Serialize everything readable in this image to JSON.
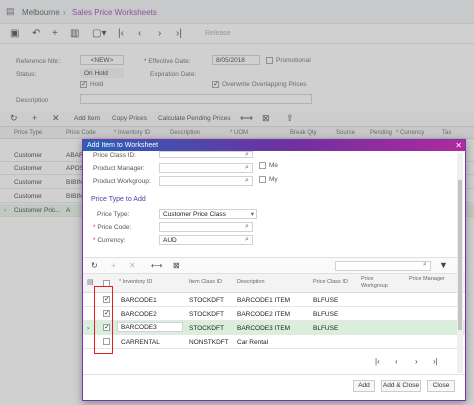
{
  "breadcrumb": {
    "site": "Melbourne",
    "separator": "›",
    "screen": "Sales Price Worksheets"
  },
  "toolbar": {
    "release_label": "Release"
  },
  "form": {
    "reference_label": "Reference Nbr.:",
    "reference_value": "<NEW>",
    "status_label": "Status:",
    "status_value": "On Hold",
    "hold_label": "Hold",
    "effective_label": "Effective Date:",
    "effective_value": "8/05/2018",
    "promotional_label": "Promotional",
    "expiration_label": "Expiration Date:",
    "overwrite_label": "Overwrite Overlapping Prices",
    "description_label": "Description"
  },
  "grid_toolbar": {
    "add_item": "Add Item",
    "copy_prices": "Copy Prices",
    "calc_pending": "Calculate Pending Prices"
  },
  "grid_headers": [
    "Price Type",
    "Price Code",
    "* Inventory ID",
    "Description",
    "* UOM",
    "Break Qty",
    "Source",
    "Pending",
    "* Currency",
    "Tax"
  ],
  "bg_rows": [
    {
      "price_type": "Customer",
      "price_code": "ABAR"
    },
    {
      "price_type": "Customer",
      "price_code": "APOS"
    },
    {
      "price_type": "Customer",
      "price_code": "BIBIN"
    },
    {
      "price_type": "Customer",
      "price_code": "BIBIN"
    },
    {
      "price_type": "Customer Pric...",
      "price_code": "A"
    }
  ],
  "dialog": {
    "title": "Add Item to Worksheet",
    "price_class_label": "Price Class ID:",
    "product_manager_label": "Product Manager:",
    "product_workgroup_label": "Product Workgroup:",
    "me_label": "Me",
    "my_label": "My",
    "section_title": "Price Type to Add",
    "price_type_label": "Price Type:",
    "price_type_value": "Customer Price Class",
    "price_code_label": "Price Code:",
    "currency_label": "Currency:",
    "currency_value": "AUD",
    "grid_headers": {
      "inventory_id": "* Inventory ID",
      "item_class": "Item Class ID",
      "description": "Description",
      "price_class": "Price Class ID",
      "price_workgroup": "Price Workgroup",
      "price_manager": "Price Manager"
    },
    "rows": [
      {
        "checked": true,
        "inventory_id": "BARCODE1",
        "item_class": "STOCKDFT",
        "description": "BARCODE1 ITEM",
        "price_class": "BLFUSE",
        "selected": false
      },
      {
        "checked": true,
        "inventory_id": "BARCODE2",
        "item_class": "STOCKDFT",
        "description": "BARCODE2 ITEM",
        "price_class": "BLFUSE",
        "selected": false
      },
      {
        "checked": true,
        "inventory_id": "BARCODE3",
        "item_class": "STOCKDFT",
        "description": "BARCODE3 ITEM",
        "price_class": "BLFUSE",
        "selected": true
      },
      {
        "checked": false,
        "inventory_id": "CARRENTAL",
        "item_class": "NONSTKDFT",
        "description": "Car Rental",
        "price_class": "",
        "selected": false
      }
    ],
    "buttons": {
      "add": "Add",
      "add_close": "Add & Close",
      "close": "Close"
    }
  },
  "colors": {
    "accent": "#7030a0",
    "title_start": "#2a60b8",
    "selection": "#d9efdc",
    "highlight_box": "#e02020"
  }
}
